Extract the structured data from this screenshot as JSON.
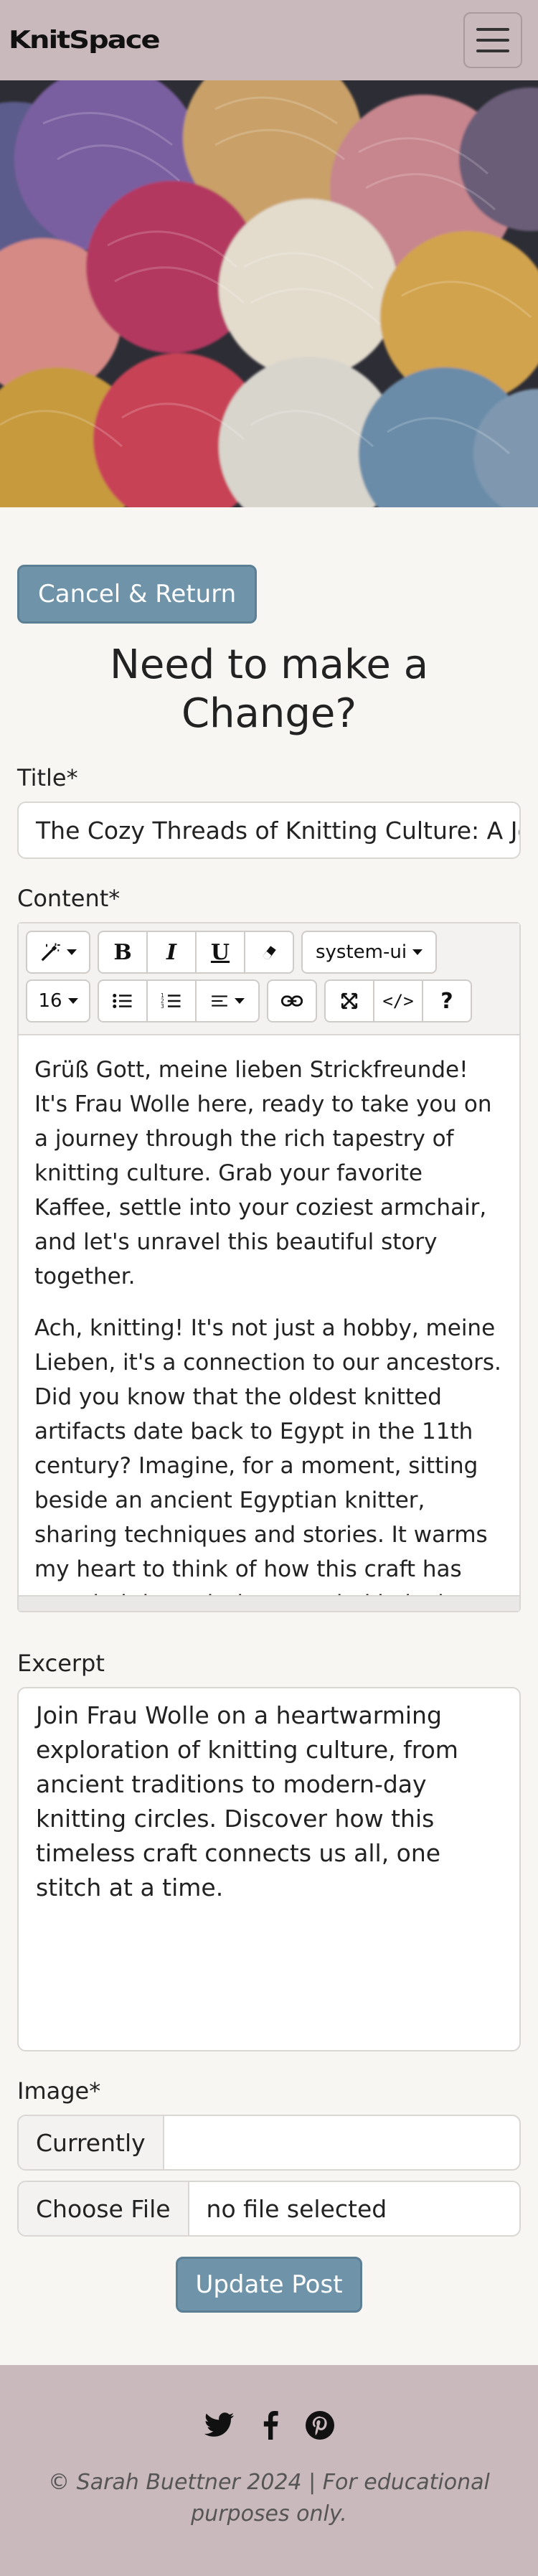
{
  "nav": {
    "brand": "KnitSpace",
    "menu_icon": "hamburger-icon"
  },
  "hero": {
    "image": "colorful yarn balls"
  },
  "form": {
    "cancel_label": "Cancel & Return",
    "heading": "Need to make a Change?",
    "title_label": "Title*",
    "title_value": "The Cozy Threads of Knitting Culture: A Journey Through Time",
    "content_label": "Content*",
    "toolbar": {
      "font_name": "system-ui",
      "font_size": "16",
      "icons": [
        "magic-icon",
        "bold-icon",
        "italic-icon",
        "underline-icon",
        "eraser-icon",
        "unordered-list-icon",
        "ordered-list-icon",
        "align-icon",
        "link-icon",
        "fullscreen-icon",
        "code-view-icon",
        "help-icon"
      ]
    },
    "content_paragraphs": [
      "Grüß Gott, meine lieben Strickfreunde! It's Frau Wolle here, ready to take you on a journey through the rich tapestry of knitting culture. Grab your favorite Kaffee, settle into your coziest armchair, and let's unravel this beautiful story together.",
      "Ach, knitting! It's not just a hobby, meine Lieben, it's a connection to our ancestors. Did you know that the oldest knitted artifacts date back to Egypt in the 11th century? Imagine, for a moment, sitting beside an ancient Egyptian knitter, sharing techniques and stories. It warms my heart to think of how this craft has traveled through time, carried in loving hands from generation to"
    ],
    "excerpt_label": "Excerpt",
    "excerpt_value": "Join Frau Wolle on a heartwarming exploration of knitting culture, from ancient traditions to modern-day knitting circles. Discover how this timeless craft connects us all, one stitch at a time.",
    "image_label": "Image*",
    "currently_label": "Currently",
    "currently_value": "",
    "choose_file_label": "Choose File",
    "file_status": "no file selected",
    "submit_label": "Update Post"
  },
  "footer": {
    "social_icons": [
      "twitter-icon",
      "facebook-icon",
      "pinterest-icon"
    ],
    "copyright": "© Sarah Buettner 2024 | For educational purposes only."
  },
  "colors": {
    "nav_bg": "#c9b9bd",
    "button_bg": "#6f93a8",
    "page_bg": "#f8f6f3"
  }
}
